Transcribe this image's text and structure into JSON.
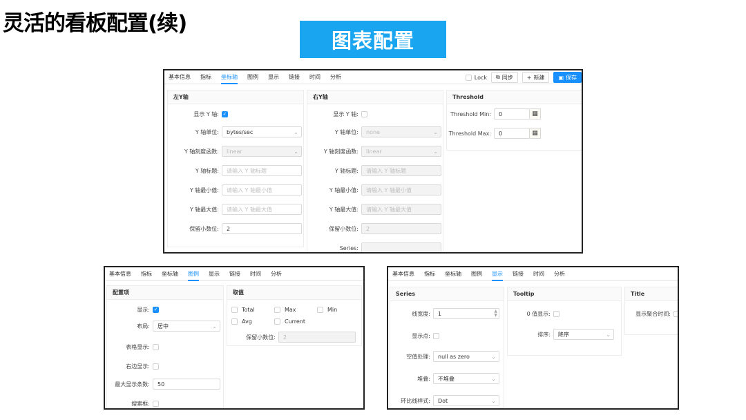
{
  "slide": {
    "title": "灵活的看板配置(续)",
    "banner": "图表配置"
  },
  "tabs": [
    "基本信息",
    "指标",
    "坐标轴",
    "图例",
    "显示",
    "链接",
    "时间",
    "分析"
  ],
  "panel1": {
    "active_tab": "坐标轴",
    "toolbar": {
      "lock": "Lock",
      "sync": "同步",
      "new": "新建",
      "save": "保存"
    },
    "left_y": {
      "title": "左Y轴",
      "show_label": "显示 Y 轴:",
      "unit_label": "Y 轴单位:",
      "unit_value": "bytes/sec",
      "scale_label": "Y 轴刻度函数:",
      "scale_value": "linear",
      "axis_title_label": "Y 轴标题:",
      "axis_title_ph": "请输入 Y 轴标题",
      "min_label": "Y 轴最小值:",
      "min_ph": "请输入 Y 轴最小值",
      "max_label": "Y 轴最大值:",
      "max_ph": "请输入 Y 轴最大值",
      "decimals_label": "保留小数位:",
      "decimals_value": "2"
    },
    "right_y": {
      "title": "右Y轴",
      "show_label": "显示 Y 轴:",
      "unit_label": "Y 轴单位:",
      "unit_value": "none",
      "scale_label": "Y 轴刻度函数:",
      "scale_value": "linear",
      "axis_title_label": "Y 轴标题:",
      "axis_title_ph": "请输入 Y 轴标题",
      "min_label": "Y 轴最小值:",
      "min_ph": "请输入 Y 轴最小值",
      "max_label": "Y 轴最大值:",
      "max_ph": "请输入 Y 轴最大值",
      "decimals_label": "保留小数位:",
      "decimals_value": "2",
      "series_label": "Series:"
    },
    "threshold": {
      "title": "Threshold",
      "min_label": "Threshold Min:",
      "min_value": "0",
      "max_label": "Threshold Max:",
      "max_value": "0"
    }
  },
  "panel2": {
    "active_tab": "图例",
    "config": {
      "title": "配置项",
      "show_label": "显示:",
      "layout_label": "布局:",
      "layout_value": "居中",
      "table_label": "表格显示:",
      "right_label": "右边显示:",
      "max_label": "最大显示条数:",
      "max_value": "50",
      "search_label": "搜索框:"
    },
    "values": {
      "title": "取值",
      "total": "Total",
      "max": "Max",
      "min": "Min",
      "avg": "Avg",
      "current": "Current",
      "decimals_label": "保留小数位:",
      "decimals_value": "2"
    }
  },
  "panel3": {
    "active_tab": "显示",
    "series": {
      "title": "Series",
      "width_label": "线宽度:",
      "width_value": "1",
      "points_label": "显示点:",
      "null_label": "空值处理:",
      "null_value": "null as zero",
      "stack_label": "堆叠:",
      "stack_value": "不堆叠",
      "ratio_label": "环比线样式:",
      "ratio_value": "Dot"
    },
    "tooltip": {
      "title": "Tooltip",
      "zero_label": "0 值显示:",
      "sort_label": "排序:",
      "sort_value": "降序"
    },
    "title_sec": {
      "title": "Title",
      "agg_label": "显示聚合时间:"
    }
  },
  "colors": {
    "accent": "#1890ff",
    "banner": "#1aa5f0"
  }
}
